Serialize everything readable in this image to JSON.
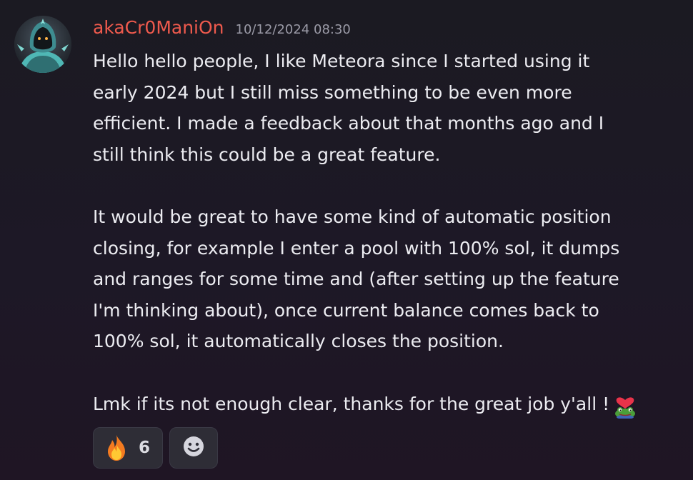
{
  "message": {
    "username": "akaCr0ManiOn",
    "timestamp": "10/12/2024 08:30",
    "avatar_icon": "hooded-figure-avatar",
    "lines": [
      "Hello hello people, I like Meteora since I started using it",
      "early 2024 but I still miss something to be even more",
      "efficient. I made a feedback about that months ago and I",
      "still think this could be a great feature.",
      "",
      "It would be great to have some kind of automatic position",
      "closing, for example I enter a pool with 100% sol, it dumps",
      "and ranges for some time and (after setting up the feature",
      "I'm thinking about), once current balance comes back to",
      "100% sol, it automatically closes the position.",
      "",
      "Lmk if its not enough clear, thanks for the great job y'all !"
    ],
    "inline_emoji": "pepe-heart-emoji"
  },
  "reactions": [
    {
      "icon": "fire-emoji",
      "count": "6"
    }
  ],
  "add_reaction_icon": "smiley-icon",
  "colors": {
    "username": "#ee5a4d",
    "timestamp": "#9b9ba7",
    "text": "#ececf1",
    "reaction_bg": "#2e2d36"
  }
}
